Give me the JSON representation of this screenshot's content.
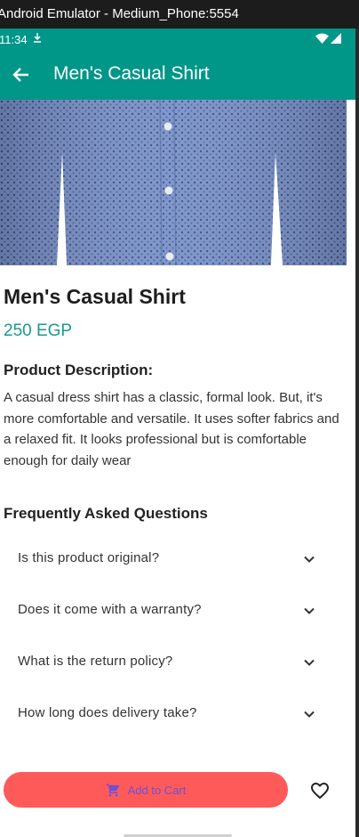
{
  "window": {
    "title": "Android Emulator - Medium_Phone:5554"
  },
  "status_bar": {
    "time": "11:34",
    "icons": [
      "download-icon",
      "wifi-icon",
      "signal-icon"
    ]
  },
  "app_bar": {
    "title": "Men's Casual Shirt",
    "back_icon": "arrow-back-icon"
  },
  "product": {
    "image_alt": "shirt-photo",
    "title": "Men's Casual Shirt",
    "price": "250 EGP",
    "description_heading": "Product Description:",
    "description": "A casual dress shirt has a classic, formal look. But, it's more comfortable and versatile. It uses softer fabrics and a relaxed fit. It looks professional but is comfortable enough for daily wear"
  },
  "faq": {
    "heading": "Frequently Asked Questions",
    "items": [
      {
        "question": "Is this product original?"
      },
      {
        "question": "Does it come with a warranty?"
      },
      {
        "question": "What is the return policy?"
      },
      {
        "question": "How long does delivery take?"
      }
    ]
  },
  "actions": {
    "add_to_cart_label": "Add to Cart",
    "cart_icon": "shopping-cart-icon",
    "favorite_icon": "heart-outline-icon"
  },
  "colors": {
    "primary": "#009688",
    "price": "#1a9a8f",
    "cart_button": "#ff5a5a",
    "cart_label": "#6b51d8"
  }
}
